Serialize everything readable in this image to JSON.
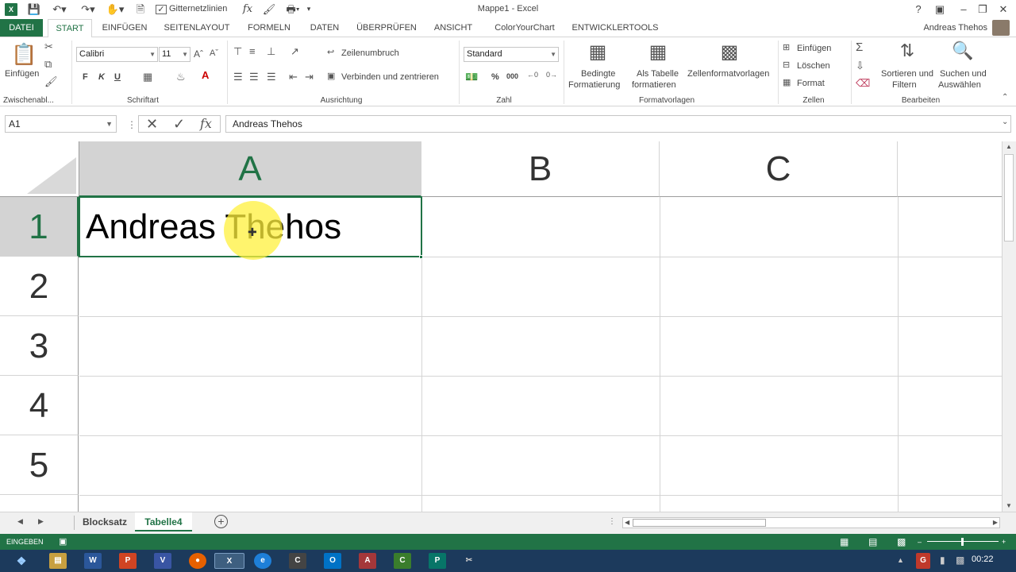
{
  "app": {
    "title": "Mappe1 - Excel",
    "user": "Andreas Thehos"
  },
  "qat": {
    "gridlines_label": "Gitternetzlinien"
  },
  "tabs": [
    "DATEI",
    "START",
    "EINFÜGEN",
    "SEITENLAYOUT",
    "FORMELN",
    "DATEN",
    "ÜBERPRÜFEN",
    "ANSICHT",
    "ColorYourChart",
    "ENTWICKLERTOOLS"
  ],
  "ribbon": {
    "clipboard": {
      "paste": "Einfügen",
      "label": "Zwischenabl..."
    },
    "font": {
      "name": "Calibri",
      "size": "11",
      "bold": "F",
      "italic": "K",
      "underline": "U",
      "label": "Schriftart"
    },
    "alignment": {
      "wrap": "Zeilenumbruch",
      "merge": "Verbinden und zentrieren",
      "label": "Ausrichtung"
    },
    "number": {
      "format": "Standard",
      "percent": "%",
      "thousands": "000",
      "label": "Zahl"
    },
    "styles": {
      "conditional1": "Bedingte",
      "conditional2": "Formatierung",
      "table1": "Als Tabelle",
      "table2": "formatieren",
      "cell": "Zellenformatvorlagen",
      "label": "Formatvorlagen"
    },
    "cells": {
      "insert": "Einfügen",
      "delete": "Löschen",
      "format": "Format",
      "label": "Zellen"
    },
    "editing": {
      "sort1": "Sortieren und",
      "sort2": "Filtern",
      "find1": "Suchen und",
      "find2": "Auswählen",
      "label": "Bearbeiten"
    }
  },
  "formula_bar": {
    "name_box": "A1",
    "content": "Andreas Thehos"
  },
  "sheet": {
    "columns": [
      "A",
      "B",
      "C"
    ],
    "rows": [
      "1",
      "2",
      "3",
      "4",
      "5"
    ],
    "cell_A1": "Andreas Thehos"
  },
  "sheets": [
    "Blocksatz",
    "Tabelle4"
  ],
  "status": {
    "mode": "EINGEBEN"
  },
  "taskbar": {
    "clock": "00:22"
  },
  "colors": {
    "accent": "#217346",
    "taskbar": "#1c3a5c"
  }
}
